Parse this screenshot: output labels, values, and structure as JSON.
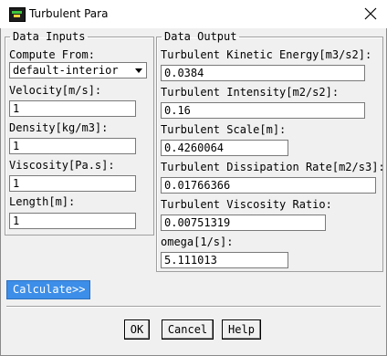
{
  "window": {
    "title": "Turbulent Para",
    "app_icon": "fluent-app-icon",
    "close_icon": "close-icon"
  },
  "inputs": {
    "legend": "Data Inputs",
    "compute_from_label": "Compute From:",
    "compute_from_value": "default-interior",
    "velocity_label": "Velocity[m/s]:",
    "velocity_value": "1",
    "density_label": "Density[kg/m3]:",
    "density_value": "1",
    "viscosity_label": "Viscosity[Pa.s]:",
    "viscosity_value": "1",
    "length_label": "Length[m]:",
    "length_value": "1"
  },
  "outputs": {
    "legend": "Data Output",
    "tke_label": "Turbulent Kinetic Energy[m3/s2]:",
    "tke_value": "0.0384",
    "intensity_label": "Turbulent Intensity[m2/s2]:",
    "intensity_value": "0.16",
    "scale_label": "Turbulent Scale[m]:",
    "scale_value": "0.4260064",
    "dissipation_label": "Turbulent Dissipation Rate[m2/s3]:",
    "dissipation_value": "0.01766366",
    "viscosity_ratio_label": "Turbulent Viscosity Ratio:",
    "viscosity_ratio_value": "0.00751319",
    "omega_label": "omega[1/s]:",
    "omega_value": "5.111013"
  },
  "actions": {
    "calculate_label": "Calculate>>",
    "ok_label": "OK",
    "cancel_label": "Cancel",
    "help_label": "Help"
  },
  "colors": {
    "calculate_button_bg": "#3c8ee8",
    "dialog_bg": "#f0f0f0"
  }
}
